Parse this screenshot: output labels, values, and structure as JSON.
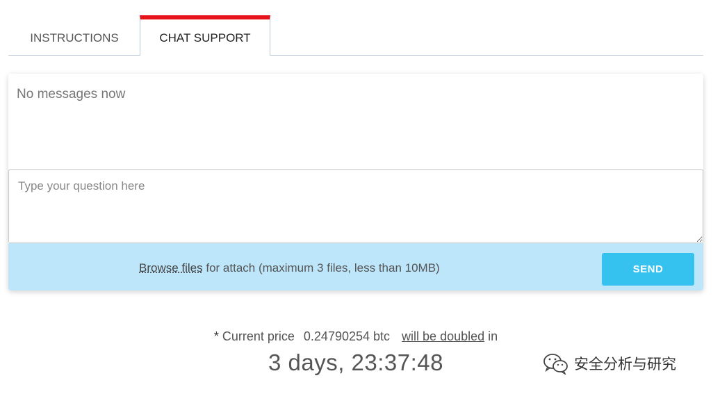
{
  "tabs": {
    "instructions": "INSTRUCTIONS",
    "chat_support": "CHAT SUPPORT"
  },
  "chat": {
    "empty_message": "No messages now",
    "question_placeholder": "Type your question here",
    "browse_label": "Browse files",
    "attach_hint": " for attach (maximum 3 files, less than 10MB)",
    "send_label": "SEND"
  },
  "price": {
    "asterisk": "*",
    "prefix": " Current price",
    "value": "0.24790254 btc",
    "doubled_label": "will be doubled",
    "suffix": " in",
    "countdown": "3 days, 23:37:48"
  },
  "watermark": {
    "text": "安全分析与研究",
    "icon": "wechat-icon"
  },
  "colors": {
    "active_tab_accent": "#e8141c",
    "attach_bar": "#bde6fb",
    "send_button": "#36c2ef"
  }
}
